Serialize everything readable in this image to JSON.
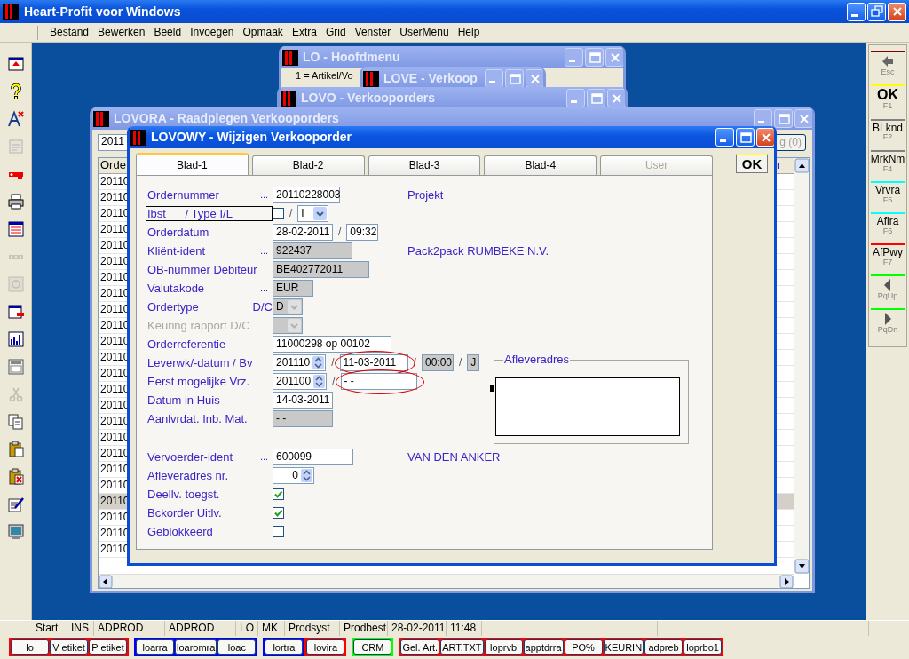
{
  "app": {
    "title": "Heart-Profit voor Windows"
  },
  "menu": [
    "Bestand",
    "Bewerken",
    "Beeld",
    "Invoegen",
    "Opmaak",
    "Extra",
    "Grid",
    "Venster",
    "UserMenu",
    "Help"
  ],
  "left_toolbar": [
    {
      "disabled": false
    },
    {
      "disabled": false
    },
    {
      "disabled": false
    },
    {
      "disabled": true
    },
    {
      "disabled": false
    },
    {
      "disabled": false
    },
    {
      "disabled": false
    },
    {
      "disabled": true
    },
    {
      "disabled": true
    },
    {
      "disabled": false
    },
    {
      "disabled": false
    },
    {
      "disabled": false
    },
    {
      "disabled": true
    },
    {
      "disabled": false
    },
    {
      "disabled": false
    },
    {
      "disabled": false
    },
    {
      "disabled": false
    },
    {
      "disabled": false
    }
  ],
  "right_toolbar": [
    {
      "kind": "icon",
      "key": "Esc",
      "color": "#800000"
    },
    {
      "kind": "text",
      "label": "OK",
      "key": "F1",
      "color": "#ffff00"
    },
    {
      "kind": "text",
      "label": "BLknd",
      "key": "F2",
      "color": "#808080"
    },
    {
      "kind": "text",
      "label": "MrkNm",
      "key": "F4",
      "color": "#808080"
    },
    {
      "kind": "text",
      "label": "Vrvra",
      "key": "F5",
      "color": "#00ffff"
    },
    {
      "kind": "text",
      "label": "Aflra",
      "key": "F6",
      "color": "#00ffff"
    },
    {
      "kind": "text",
      "label": "AfPwy",
      "key": "F7",
      "color": "#ff0000"
    },
    {
      "kind": "icon",
      "key": "PqUp",
      "color": "#00ff00"
    },
    {
      "kind": "icon",
      "key": "PqDn",
      "color": "#00ff00"
    }
  ],
  "background_windows": [
    {
      "title": "LO - Hoofdmenu",
      "lines": [
        "1 = Artikel/Vo"
      ]
    },
    {
      "title": "LOVE - Verkoop"
    },
    {
      "title": "LOVO - Verkooporders"
    }
  ],
  "list_window": {
    "title": "LOVORA - Raadplegen Verkooporders",
    "filter_value": "2011",
    "button": "g (0)",
    "columns": [
      "Orde",
      "r"
    ],
    "rows": [
      {
        "cells": [
          "20110"
        ],
        "selected": false
      },
      {
        "cells": [
          "20110"
        ],
        "selected": false
      },
      {
        "cells": [
          "20110"
        ],
        "selected": false
      },
      {
        "cells": [
          "20110"
        ],
        "selected": false
      },
      {
        "cells": [
          "20110"
        ],
        "selected": false
      },
      {
        "cells": [
          "20110"
        ],
        "selected": false
      },
      {
        "cells": [
          "20110"
        ],
        "selected": false
      },
      {
        "cells": [
          "20110"
        ],
        "selected": false
      },
      {
        "cells": [
          "20110"
        ],
        "selected": false
      },
      {
        "cells": [
          "20110"
        ],
        "selected": false
      },
      {
        "cells": [
          "20110"
        ],
        "selected": false
      },
      {
        "cells": [
          "20110"
        ],
        "selected": false
      },
      {
        "cells": [
          "20110"
        ],
        "selected": false
      },
      {
        "cells": [
          "20110"
        ],
        "selected": false
      },
      {
        "cells": [
          "20110"
        ],
        "selected": false
      },
      {
        "cells": [
          "20110"
        ],
        "selected": false
      },
      {
        "cells": [
          "20110"
        ],
        "selected": false
      },
      {
        "cells": [
          "20110"
        ],
        "selected": false
      },
      {
        "cells": [
          "20110"
        ],
        "selected": false
      },
      {
        "cells": [
          "20110"
        ],
        "selected": false
      },
      {
        "cells": [
          "20110"
        ],
        "selected": true
      },
      {
        "cells": [
          "20110"
        ],
        "selected": false
      },
      {
        "cells": [
          "20110"
        ],
        "selected": false
      },
      {
        "cells": [
          "20110"
        ],
        "selected": false
      }
    ]
  },
  "order_window": {
    "title": "LOVOWY - Wijzigen Verkooporder",
    "ok_button": "OK",
    "tabs": [
      {
        "label": "Blad-1",
        "selected": true,
        "disabled": false
      },
      {
        "label": "Blad-2",
        "selected": false,
        "disabled": false
      },
      {
        "label": "Blad-3",
        "selected": false,
        "disabled": false
      },
      {
        "label": "Blad-4",
        "selected": false,
        "disabled": false
      },
      {
        "label": "User",
        "selected": false,
        "disabled": true
      }
    ],
    "fields": [
      {
        "label": "Ordernummer",
        "dots": "...",
        "disabled": false,
        "controls": [
          {
            "kind": "input",
            "value": "20110228003",
            "readonly": false
          }
        ],
        "side_text": "Projekt"
      },
      {
        "label": "Ibst      / Type I/L",
        "disabled": false,
        "focused": true,
        "controls": [
          {
            "kind": "check",
            "checked": false
          },
          {
            "kind": "sep",
            "text": "/"
          },
          {
            "kind": "select",
            "value": "I",
            "disabled": false
          }
        ]
      },
      {
        "label": "Orderdatum",
        "disabled": false,
        "controls": [
          {
            "kind": "input",
            "value": "28-02-2011",
            "readonly": false
          },
          {
            "kind": "sep",
            "text": "/"
          },
          {
            "kind": "input",
            "value": "09:32",
            "readonly": false
          }
        ]
      },
      {
        "label": "Kliënt-ident",
        "dots": "...",
        "disabled": false,
        "controls": [
          {
            "kind": "input",
            "value": "922437",
            "readonly": true
          }
        ],
        "side_text": "Pack2pack RUMBEKE N.V."
      },
      {
        "label": "OB-nummer Debiteur",
        "disabled": false,
        "controls": [
          {
            "kind": "input",
            "value": "BE402772011",
            "readonly": true
          }
        ]
      },
      {
        "label": "Valutakode",
        "dots": "...",
        "disabled": false,
        "controls": [
          {
            "kind": "input",
            "value": "EUR",
            "readonly": true
          }
        ]
      },
      {
        "label": "Ordertype",
        "suffix": "D/C",
        "disabled": false,
        "controls": [
          {
            "kind": "select",
            "value": "D",
            "disabled": true
          }
        ]
      },
      {
        "label": "Keuring rapport D/C",
        "disabled": true,
        "controls": [
          {
            "kind": "select",
            "disabled": true
          }
        ]
      },
      {
        "label": "Orderreferentie",
        "disabled": false,
        "controls": [
          {
            "kind": "input",
            "value": "11000298 op 00102",
            "readonly": false
          }
        ]
      },
      {
        "label": "Leverwk/-datum / Bv",
        "disabled": false,
        "controls": [
          {
            "kind": "spin",
            "value": "201110"
          },
          {
            "kind": "sep",
            "text": "/"
          },
          {
            "kind": "input",
            "value": "11-03-2011",
            "readonly": false,
            "highlighted": true
          },
          {
            "kind": "sep",
            "text": "/"
          },
          {
            "kind": "input",
            "value": "00:00",
            "readonly": true
          },
          {
            "kind": "sep",
            "text": "/"
          },
          {
            "kind": "input",
            "value": "J",
            "readonly": true
          }
        ]
      },
      {
        "label": "Eerst mogelijke Vrz.",
        "disabled": false,
        "controls": [
          {
            "kind": "spin",
            "value": "201100"
          },
          {
            "kind": "sep",
            "text": "/"
          },
          {
            "kind": "input",
            "value": "- -",
            "readonly": false,
            "highlighted": true
          }
        ]
      },
      {
        "label": "Datum in Huis",
        "disabled": false,
        "controls": [
          {
            "kind": "input",
            "value": "14-03-2011",
            "readonly": false
          }
        ]
      },
      {
        "label": "Aanlvrdat. Inb. Mat.",
        "disabled": false,
        "controls": [
          {
            "kind": "input",
            "value": "- -",
            "readonly": true
          }
        ]
      }
    ],
    "transport_fields": [
      {
        "label": "Vervoerder-ident",
        "dots": "...",
        "disabled": false,
        "controls": [
          {
            "kind": "input",
            "value": "600099",
            "readonly": false
          }
        ],
        "side_text": "VAN DEN ANKER"
      },
      {
        "label": "Afleveradres nr.",
        "disabled": false,
        "controls": [
          {
            "kind": "spin",
            "value": "0"
          }
        ]
      },
      {
        "label": "Deellv. toegst.",
        "disabled": false,
        "controls": [
          {
            "kind": "check",
            "checked": true
          }
        ]
      },
      {
        "label": "Bckorder Uitlv.",
        "disabled": false,
        "controls": [
          {
            "kind": "check",
            "checked": true
          }
        ]
      },
      {
        "label": "Geblokkeerd",
        "disabled": false,
        "controls": [
          {
            "kind": "check",
            "checked": false
          }
        ]
      }
    ],
    "delivery_address": {
      "label": "Afleveradres"
    }
  },
  "status_bar": [
    "Start",
    "INS",
    "ADPROD",
    "ADPROD",
    "LO",
    "MK",
    "Prodsyst",
    "Prodbest",
    "28-02-2011",
    "11:48"
  ],
  "taskbar_groups": [
    {
      "color": "#ff0000",
      "buttons": [
        "lo",
        "V etiket",
        "P etiket"
      ]
    },
    {
      "color": "#0000ff",
      "buttons": [
        "loarra",
        "loaromra",
        "loac"
      ]
    },
    {
      "color": "#0000ff",
      "buttons": [
        "lortra"
      ]
    },
    {
      "color": "#ff0000",
      "buttons": [
        "lovira"
      ]
    },
    {
      "color": "#00ff00",
      "buttons": [
        "CRM"
      ]
    },
    {
      "color": "#ff0000",
      "buttons": [
        "Gel. Art.",
        "ART.TXT",
        "loprvb",
        "apptdrra",
        "PO%",
        "KEURIN",
        "adpreb",
        "loprbo1"
      ]
    }
  ]
}
